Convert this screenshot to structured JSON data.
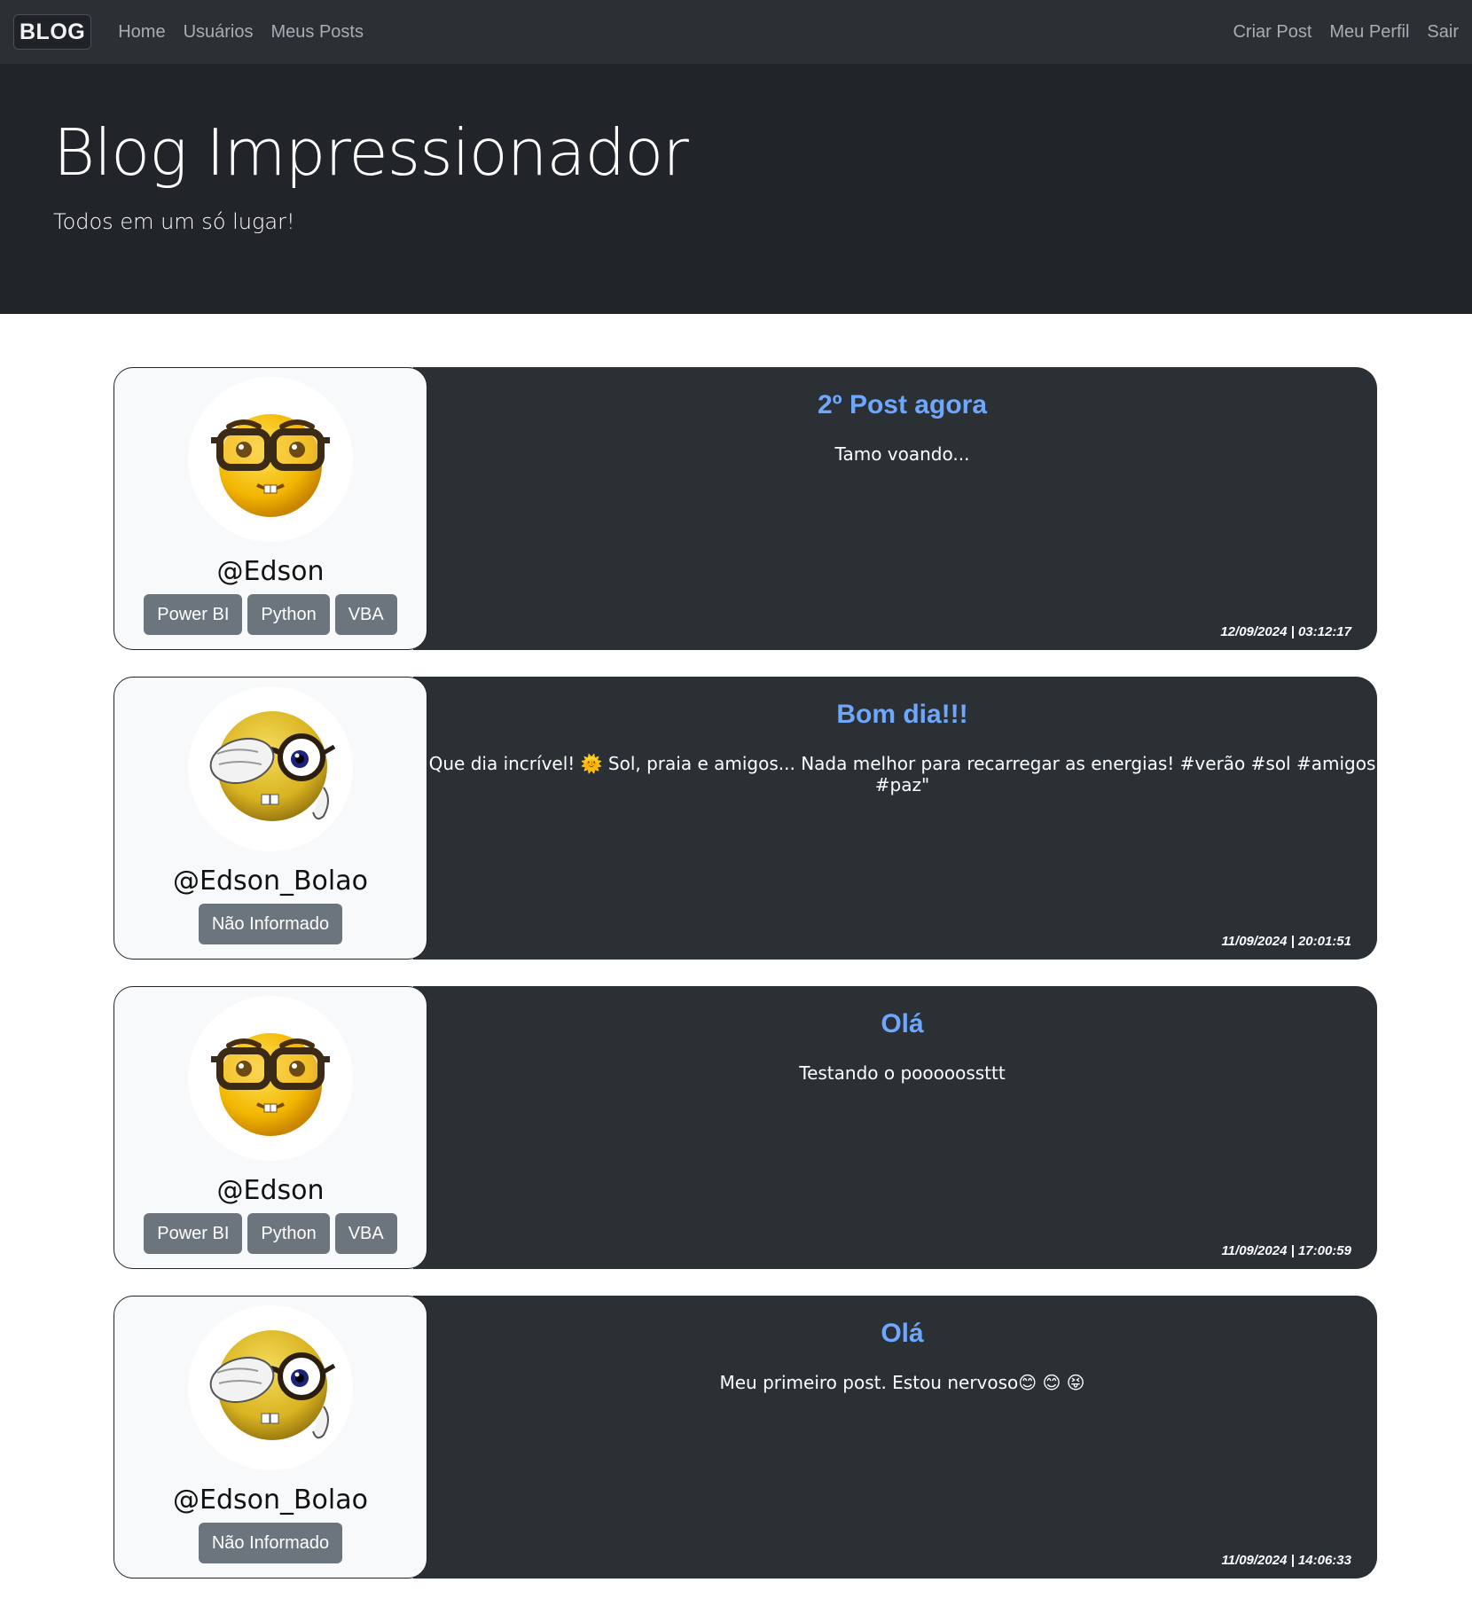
{
  "navbar": {
    "brand": "BLOG",
    "left_links": [
      "Home",
      "Usuários",
      "Meus Posts"
    ],
    "right_links": [
      "Criar Post",
      "Meu Perfil",
      "Sair"
    ]
  },
  "hero": {
    "title": "Blog Impressionador",
    "subtitle": "Todos em um só lugar!"
  },
  "posts": [
    {
      "avatar_icon": "nerd-face-icon",
      "username": "@Edson",
      "tags": [
        "Power BI",
        "Python",
        "VBA"
      ],
      "title": "2º Post agora",
      "body": "Tamo voando...",
      "date": "12/09/2024 | 03:12:17"
    },
    {
      "avatar_icon": "thinking-nerd-face-icon",
      "username": "@Edson_Bolao",
      "tags": [
        "Não Informado"
      ],
      "title": "Bom dia!!!",
      "body": "Que dia incrível! 🌞 Sol, praia e amigos... Nada melhor para recarregar as energias! #verão #sol #amigos #paz\"",
      "date": "11/09/2024 | 20:01:51"
    },
    {
      "avatar_icon": "nerd-face-icon",
      "username": "@Edson",
      "tags": [
        "Power BI",
        "Python",
        "VBA"
      ],
      "title": "Olá",
      "body": "Testando o pooooossttt",
      "date": "11/09/2024 | 17:00:59"
    },
    {
      "avatar_icon": "thinking-nerd-face-icon",
      "username": "@Edson_Bolao",
      "tags": [
        "Não Informado"
      ],
      "title": "Olá",
      "body": "Meu primeiro post. Estou nervoso😊 😊 😝",
      "date": "11/09/2024 | 14:06:33"
    }
  ]
}
